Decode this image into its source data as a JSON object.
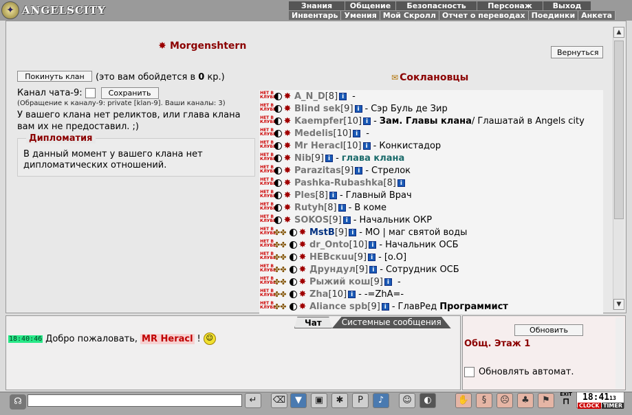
{
  "logo": {
    "text": "ANGELSCITY"
  },
  "menu_top": [
    "Знания",
    "Общение",
    "Безопасность",
    "Персонаж",
    "Выход"
  ],
  "menu_sub": [
    "Инвентарь",
    "Умения",
    "Мой Скролл",
    "Отчет о переводах",
    "Поединки",
    "Анкета"
  ],
  "clan": {
    "name": "Morgenshtern",
    "back_label": "Вернуться",
    "leave_label": "Покинуть клан",
    "leave_cost_pre": "(это вам обойдется в ",
    "leave_cost_num": "0",
    "leave_cost_post": " кр.)",
    "channel_label": "Канал чата-9:",
    "save_label": "Сохранить",
    "channel_hint": "(Обращение к каналу-9: private [klan-9]. Ваши каналы: 3)",
    "relics_text": "У вашего клана нет реликтов, или глава клана вам их не предоставил. ;)",
    "diplomacy_title": "Дипломатия",
    "diplomacy_text": "В данный момент у вашего клана нет дипломатических отношений."
  },
  "members_title": "Соклановцы",
  "members": [
    {
      "name": "A_N_D",
      "level": "[8]",
      "role": "-",
      "role_style": "",
      "extra": false
    },
    {
      "name": "Blind sek",
      "level": "[9]",
      "role": "Сэр Буль де Зир",
      "role_style": "",
      "extra": false
    },
    {
      "name": "Kaempfer",
      "level": "[10]",
      "role": "Зам. Главы клана",
      "role2": " / Глашатай в Angels city",
      "role_style": "b",
      "extra": false
    },
    {
      "name": "Medelis",
      "level": "[10]",
      "role": "-",
      "role_style": "",
      "extra": false
    },
    {
      "name": "Mr Heracl",
      "level": "[10]",
      "role": "Конкистадор",
      "role_style": "",
      "extra": false
    },
    {
      "name": "Nib",
      "level": "[9]",
      "role": "глава клана",
      "role_style": "g",
      "extra": false
    },
    {
      "name": "Parazitas",
      "level": "[9]",
      "role": "Стрелок",
      "role_style": "",
      "extra": false
    },
    {
      "name": "Pashka-Rubashka",
      "level": "[8]",
      "role": "",
      "role_style": "",
      "extra": false
    },
    {
      "name": "Ples",
      "level": "[8]",
      "role": "Главный Врач",
      "role_style": "",
      "extra": false
    },
    {
      "name": "Rutyh",
      "level": "[8]",
      "role": "В коме",
      "role_style": "",
      "extra": false
    },
    {
      "name": "SOKOS",
      "level": "[9]",
      "role": "Начальник ОКР",
      "role_style": "",
      "extra": false
    },
    {
      "name": "MstB",
      "level": "[9]",
      "role": "МО | маг святой воды",
      "role_style": "",
      "extra": true,
      "blue": true
    },
    {
      "name": "dr_Onto",
      "level": "[10]",
      "role": "Начальник ОСБ",
      "role_style": "",
      "extra": true
    },
    {
      "name": "НЕВскuu",
      "level": "[9]",
      "role": "[o.O]",
      "role_style": "",
      "extra": true
    },
    {
      "name": "Друндул",
      "level": "[9]",
      "role": "Сотрудник ОСБ",
      "role_style": "",
      "extra": true
    },
    {
      "name": "Рыжий кош",
      "level": "[9]",
      "role": "-",
      "role_style": "",
      "extra": true
    },
    {
      "name": "Zha",
      "level": "[10]",
      "role": "-=ZhA=-",
      "role_style": "",
      "extra": true
    },
    {
      "name": "Aliance spb",
      "level": "[9]",
      "role": "ГлавРед",
      "role2": " Программист",
      "role_style": "",
      "role2_bold": true,
      "extra": true
    }
  ],
  "chat": {
    "tab_chat": "Чат",
    "tab_system": "Системные сообщения",
    "timestamp": "18:40:46",
    "greeting_pre": "Добро пожаловать, ",
    "user": "MR Heracl",
    "greeting_post": "!"
  },
  "right_panel": {
    "refresh_label": "Обновить",
    "location": "Общ. Этаж 1",
    "auto_label": "Обновлять автомат."
  },
  "bottom": {
    "exit_label": "EXIT",
    "clock_time": "18:41",
    "clock_sec": "13",
    "clock_label": "CLOCK",
    "timer_label": "TIMER"
  }
}
